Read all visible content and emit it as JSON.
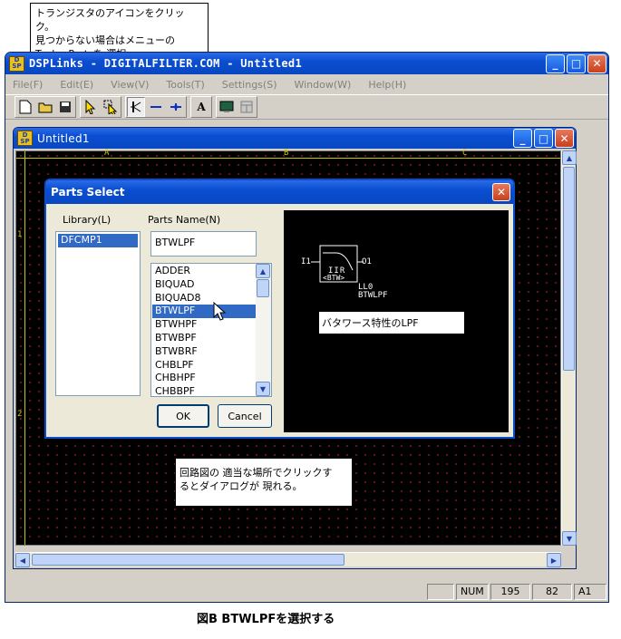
{
  "callouts": {
    "top": "トランジスタのアイコンをクリック。\n見つからない場合はメニューの\nTools→Partsを 選択。",
    "bottom": "回路図の 適当な場所でクリックす\nるとダイアログが 現れる。"
  },
  "main_window": {
    "title": "DSPLinks - DIGITALFILTER.COM - Untitled1",
    "menu": [
      "File(F)",
      "Edit(E)",
      "View(V)",
      "Tools(T)",
      "Settings(S)",
      "Window(W)",
      "Help(H)"
    ]
  },
  "child_window": {
    "title": "Untitled1",
    "ruler_columns": [
      "A",
      "B",
      "C"
    ],
    "ruler_rows": [
      "1",
      "2"
    ]
  },
  "dialog": {
    "title": "Parts Select",
    "library_label": "Library(L)",
    "parts_name_label": "Parts Name(N)",
    "library_items": [
      "DFCMP1"
    ],
    "parts_name_value": "BTWLPF",
    "parts_list": [
      "ADDER",
      "BIQUAD",
      "BIQUAD8",
      "BTWLPF",
      "BTWHPF",
      "BTWBPF",
      "BTWBRF",
      "CHBLPF",
      "CHBHPF",
      "CHBBPF"
    ],
    "selected_part": "BTWLPF",
    "ok_label": "OK",
    "cancel_label": "Cancel",
    "preview": {
      "input_pin": "I1",
      "output_pin": "O1",
      "block_line1": "IIR",
      "block_line2": "<BTW>",
      "instance": "LL0",
      "part_name": "BTWLPF",
      "description": "バタワース特性のLPF"
    }
  },
  "status_bar": {
    "mode": "NUM",
    "x": "195",
    "y": "82",
    "cell": "A1"
  },
  "caption": "図B BTWLPFを選択する",
  "colors": {
    "title_bar": "#0a4ed0",
    "selection": "#316ac5",
    "ruler": "#c8c800",
    "grid_dot": "#8a1a1a"
  }
}
